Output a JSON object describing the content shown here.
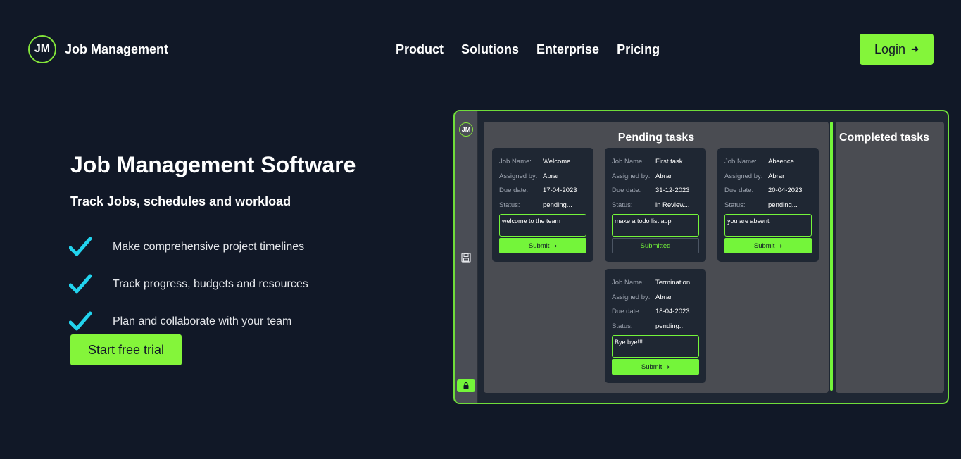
{
  "header": {
    "logo_initials": "JM",
    "brand": "Job Management",
    "nav": [
      "Product",
      "Solutions",
      "Enterprise",
      "Pricing"
    ],
    "login_label": "Login",
    "login_arrow": "➜"
  },
  "hero": {
    "title": "Job Management Software",
    "subtitle": "Track Jobs, schedules and workload",
    "features": [
      "Make comprehensive project timelines",
      "Track progress, budgets and resources",
      "Plan and collaborate with your team"
    ],
    "cta_label": "Start free trial"
  },
  "preview": {
    "logo_initials": "JM",
    "pending_title": "Pending tasks",
    "completed_title": "Completed tasks",
    "labels": {
      "job_name": "Job Name:",
      "assigned_by": "Assigned by:",
      "due_date": "Due date:",
      "status": "Status:"
    },
    "cards": [
      {
        "job_name": "Welcome",
        "assigned_by": "Abrar",
        "due_date": "17-04-2023",
        "status": "pending...",
        "note": "welcome to the team",
        "button": "Submit",
        "submitted": false
      },
      {
        "job_name": "First task",
        "assigned_by": "Abrar",
        "due_date": "31-12-2023",
        "status": "in Review...",
        "note": "make a todo list app",
        "button": "Submitted",
        "submitted": true
      },
      {
        "job_name": "Absence",
        "assigned_by": "Abrar",
        "due_date": "20-04-2023",
        "status": "pending...",
        "note": "you are absent",
        "button": "Submit",
        "submitted": false
      },
      {
        "job_name": "Termination",
        "assigned_by": "Abrar",
        "due_date": "18-04-2023",
        "status": "pending...",
        "note": "Bye bye!!!",
        "button": "Submit",
        "submitted": false
      }
    ],
    "button_arrow": "➜"
  },
  "colors": {
    "background": "#111827",
    "accent": "#84f53a",
    "check": "#22d3ee",
    "panel": "#4a4c52",
    "card": "#1f2733"
  }
}
